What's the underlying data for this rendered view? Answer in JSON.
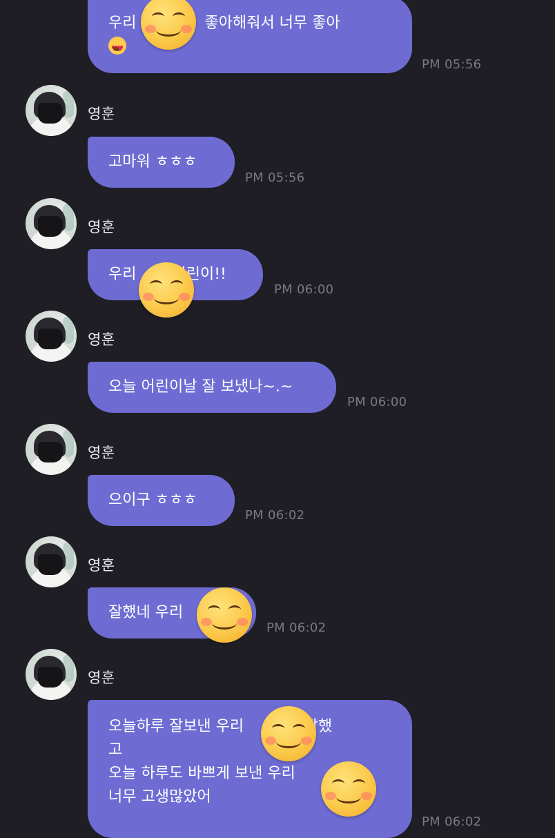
{
  "sender_name": "영훈",
  "messages": [
    {
      "lines": [
        "우리 ",
        "좋아해줘서 너무 좋아"
      ],
      "emoji": "smiling-face-with-heart-eyes",
      "time": "PM 05:56"
    },
    {
      "text": "고마워 ㅎㅎㅎ",
      "time": "PM 05:56"
    },
    {
      "text_a": "우리",
      "text_b": "어린이!!",
      "time": "PM 06:00"
    },
    {
      "text": "오늘 어린이날 잘 보냈나~.~",
      "time": "PM 06:00"
    },
    {
      "text": "으이구 ㅎㅎㅎ",
      "time": "PM 06:02"
    },
    {
      "text": "잘했네 우리",
      "time": "PM 06:02"
    },
    {
      "line1_a": "오늘하루 잘보낸 우리",
      "line1_b": "너무 잘했",
      "line2": "고",
      "line3_a": "오늘 하루도 바쁘게 보낸 우리",
      "line3_b": "도",
      "line4": "너무 고생많았어",
      "time": "PM 06:02"
    }
  ],
  "colors": {
    "background": "#1f1e25",
    "bubble": "#6e6cd3",
    "timestamp": "#7a7886",
    "name": "#eceaf2"
  },
  "icons": {
    "avatar": "profile-photo-masked-person",
    "sticker": "smiling-face-emoji"
  }
}
